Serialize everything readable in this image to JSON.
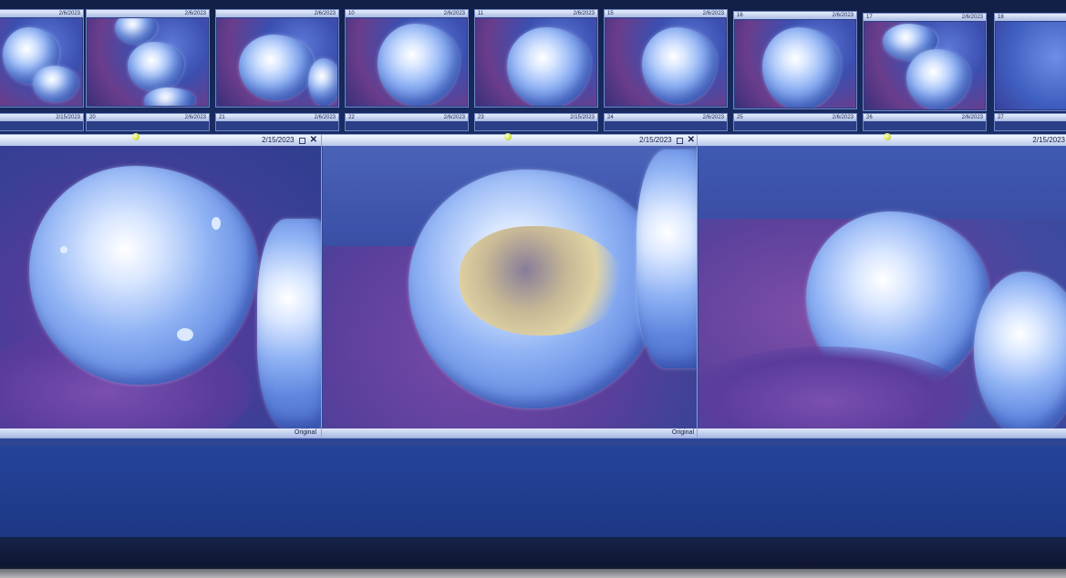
{
  "thumbnails_top": [
    {
      "num": "",
      "date": "2/6/2023"
    },
    {
      "num": "",
      "date": "2/6/2023"
    },
    {
      "num": "",
      "date": "2/6/2023"
    },
    {
      "num": "10",
      "date": "2/6/2023"
    },
    {
      "num": "11",
      "date": "2/6/2023"
    },
    {
      "num": "15",
      "date": "2/6/2023"
    },
    {
      "num": "16",
      "date": "2/6/2023"
    },
    {
      "num": "17",
      "date": "2/6/2023"
    },
    {
      "num": "18",
      "date": ""
    }
  ],
  "thumbnails_bottom": [
    {
      "num": "",
      "date": "2/15/2023"
    },
    {
      "num": "20",
      "date": "2/6/2023"
    },
    {
      "num": "21",
      "date": "2/6/2023"
    },
    {
      "num": "22",
      "date": "2/6/2023"
    },
    {
      "num": "23",
      "date": "2/15/2023"
    },
    {
      "num": "24",
      "date": "2/6/2023"
    },
    {
      "num": "25",
      "date": "2/6/2023"
    },
    {
      "num": "26",
      "date": "2/6/2023"
    },
    {
      "num": "27",
      "date": ""
    }
  ],
  "panels": [
    {
      "date": "2/15/2023",
      "footer": "Original"
    },
    {
      "date": "2/15/2023",
      "footer": "Original"
    },
    {
      "date": "2/15/2023",
      "footer": ""
    }
  ],
  "colors": {
    "background": "#1e3a86",
    "panel_titlebar": "#f5f8ff",
    "tooth_highlight": "#d8e6ff",
    "gum": "#6a3d8c"
  },
  "icons": {
    "close": "close-icon",
    "maximize": "maximize-icon",
    "pin": "pin-icon"
  }
}
